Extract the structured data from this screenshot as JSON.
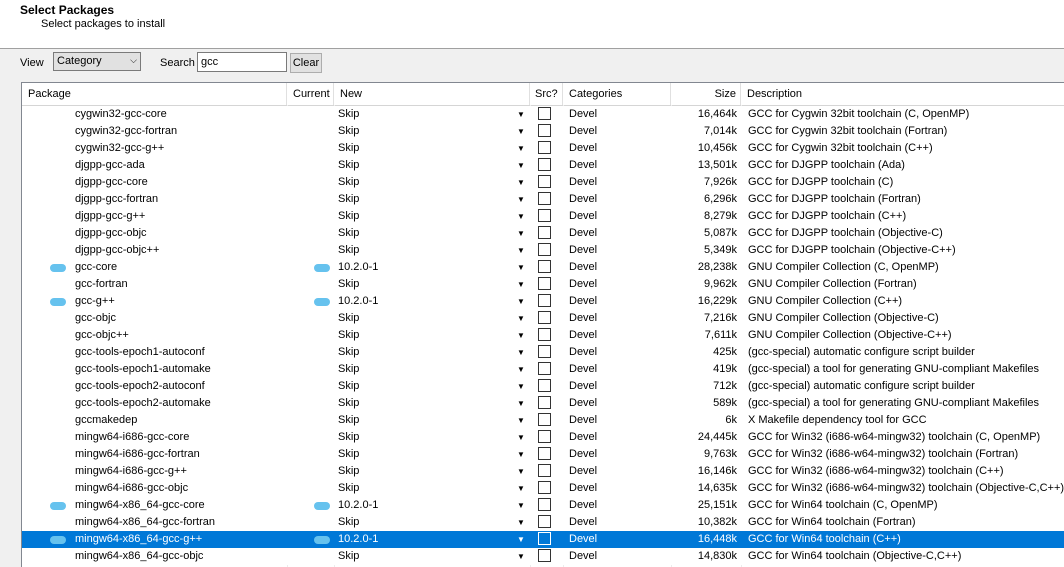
{
  "header": {
    "title": "Select Packages",
    "subtitle": "Select packages to install"
  },
  "toolbar": {
    "view_label": "View",
    "view_value": "Category",
    "search_label": "Search",
    "search_value": "gcc",
    "clear_label": "Clear"
  },
  "columns": {
    "package": "Package",
    "current": "Current",
    "new": "New",
    "src": "Src?",
    "categories": "Categories",
    "size": "Size",
    "description": "Description"
  },
  "rows": [
    {
      "package": "cygwin32-gcc-core",
      "current": "",
      "new": "Skip",
      "category": "Devel",
      "size": "16,464k",
      "description": "GCC for Cygwin 32bit toolchain (C, OpenMP)"
    },
    {
      "package": "cygwin32-gcc-fortran",
      "current": "",
      "new": "Skip",
      "category": "Devel",
      "size": "7,014k",
      "description": "GCC for Cygwin 32bit toolchain (Fortran)"
    },
    {
      "package": "cygwin32-gcc-g++",
      "current": "",
      "new": "Skip",
      "category": "Devel",
      "size": "10,456k",
      "description": "GCC for Cygwin 32bit toolchain (C++)"
    },
    {
      "package": "djgpp-gcc-ada",
      "current": "",
      "new": "Skip",
      "category": "Devel",
      "size": "13,501k",
      "description": "GCC for DJGPP toolchain (Ada)"
    },
    {
      "package": "djgpp-gcc-core",
      "current": "",
      "new": "Skip",
      "category": "Devel",
      "size": "7,926k",
      "description": "GCC for DJGPP toolchain (C)"
    },
    {
      "package": "djgpp-gcc-fortran",
      "current": "",
      "new": "Skip",
      "category": "Devel",
      "size": "6,296k",
      "description": "GCC for DJGPP toolchain (Fortran)"
    },
    {
      "package": "djgpp-gcc-g++",
      "current": "",
      "new": "Skip",
      "category": "Devel",
      "size": "8,279k",
      "description": "GCC for DJGPP toolchain (C++)"
    },
    {
      "package": "djgpp-gcc-objc",
      "current": "",
      "new": "Skip",
      "category": "Devel",
      "size": "5,087k",
      "description": "GCC for DJGPP toolchain (Objective-C)"
    },
    {
      "package": "djgpp-gcc-objc++",
      "current": "",
      "new": "Skip",
      "category": "Devel",
      "size": "5,349k",
      "description": "GCC for DJGPP toolchain (Objective-C++)"
    },
    {
      "package": "gcc-core",
      "current": "",
      "new": "10.2.0-1",
      "category": "Devel",
      "size": "28,238k",
      "description": "GNU Compiler Collection (C, OpenMP)",
      "marked": true
    },
    {
      "package": "gcc-fortran",
      "current": "",
      "new": "Skip",
      "category": "Devel",
      "size": "9,962k",
      "description": "GNU Compiler Collection (Fortran)"
    },
    {
      "package": "gcc-g++",
      "current": "",
      "new": "10.2.0-1",
      "category": "Devel",
      "size": "16,229k",
      "description": "GNU Compiler Collection (C++)",
      "marked": true
    },
    {
      "package": "gcc-objc",
      "current": "",
      "new": "Skip",
      "category": "Devel",
      "size": "7,216k",
      "description": "GNU Compiler Collection (Objective-C)"
    },
    {
      "package": "gcc-objc++",
      "current": "",
      "new": "Skip",
      "category": "Devel",
      "size": "7,611k",
      "description": "GNU Compiler Collection (Objective-C++)"
    },
    {
      "package": "gcc-tools-epoch1-autoconf",
      "current": "",
      "new": "Skip",
      "category": "Devel",
      "size": "425k",
      "description": "(gcc-special) automatic configure script builder"
    },
    {
      "package": "gcc-tools-epoch1-automake",
      "current": "",
      "new": "Skip",
      "category": "Devel",
      "size": "419k",
      "description": "(gcc-special) a tool for generating GNU-compliant Makefiles"
    },
    {
      "package": "gcc-tools-epoch2-autoconf",
      "current": "",
      "new": "Skip",
      "category": "Devel",
      "size": "712k",
      "description": "(gcc-special) automatic configure script builder"
    },
    {
      "package": "gcc-tools-epoch2-automake",
      "current": "",
      "new": "Skip",
      "category": "Devel",
      "size": "589k",
      "description": "(gcc-special) a tool for generating GNU-compliant Makefiles"
    },
    {
      "package": "gccmakedep",
      "current": "",
      "new": "Skip",
      "category": "Devel",
      "size": "6k",
      "description": "X Makefile dependency tool for GCC"
    },
    {
      "package": "mingw64-i686-gcc-core",
      "current": "",
      "new": "Skip",
      "category": "Devel",
      "size": "24,445k",
      "description": "GCC for Win32 (i686-w64-mingw32) toolchain (C, OpenMP)"
    },
    {
      "package": "mingw64-i686-gcc-fortran",
      "current": "",
      "new": "Skip",
      "category": "Devel",
      "size": "9,763k",
      "description": "GCC for Win32 (i686-w64-mingw32) toolchain (Fortran)"
    },
    {
      "package": "mingw64-i686-gcc-g++",
      "current": "",
      "new": "Skip",
      "category": "Devel",
      "size": "16,146k",
      "description": "GCC for Win32 (i686-w64-mingw32) toolchain (C++)"
    },
    {
      "package": "mingw64-i686-gcc-objc",
      "current": "",
      "new": "Skip",
      "category": "Devel",
      "size": "14,635k",
      "description": "GCC for Win32 (i686-w64-mingw32) toolchain (Objective-C,C++)"
    },
    {
      "package": "mingw64-x86_64-gcc-core",
      "current": "",
      "new": "10.2.0-1",
      "category": "Devel",
      "size": "25,151k",
      "description": "GCC for Win64 toolchain (C, OpenMP)",
      "marked": true
    },
    {
      "package": "mingw64-x86_64-gcc-fortran",
      "current": "",
      "new": "Skip",
      "category": "Devel",
      "size": "10,382k",
      "description": "GCC for Win64 toolchain (Fortran)"
    },
    {
      "package": "mingw64-x86_64-gcc-g++",
      "current": "",
      "new": "10.2.0-1",
      "category": "Devel",
      "size": "16,448k",
      "description": "GCC for Win64 toolchain (C++)",
      "marked": true,
      "selected": true
    },
    {
      "package": "mingw64-x86_64-gcc-objc",
      "current": "",
      "new": "Skip",
      "category": "Devel",
      "size": "14,830k",
      "description": "GCC for Win64 toolchain (Objective-C,C++)"
    }
  ],
  "colors": {
    "selection": "#0078d7",
    "marker": "#66c2ee"
  },
  "icons": {
    "dropdown": "chevron-down-icon"
  }
}
